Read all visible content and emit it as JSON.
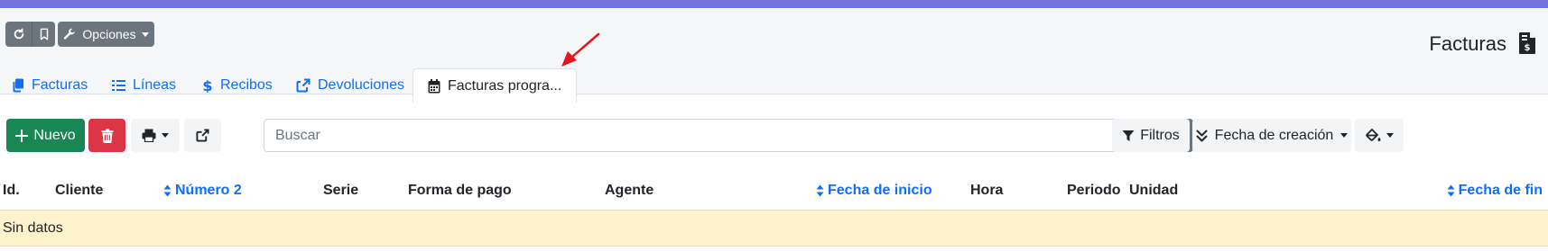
{
  "header": {
    "options_label": "Opciones",
    "page_title": "Facturas"
  },
  "tabs": [
    {
      "label": "Facturas",
      "icon": "copy-icon"
    },
    {
      "label": "Líneas",
      "icon": "list-icon"
    },
    {
      "label": "Recibos",
      "icon": "dollar-icon"
    },
    {
      "label": "Devoluciones",
      "icon": "share-square-icon"
    },
    {
      "label": "Facturas progra...",
      "icon": "calendar-icon",
      "active": true
    }
  ],
  "toolbar": {
    "new_label": "Nuevo",
    "search_placeholder": "Buscar",
    "filters_label": "Filtros",
    "order_label": "Fecha de creación"
  },
  "table": {
    "columns": [
      {
        "label": "Id.",
        "sortable": false
      },
      {
        "label": "Cliente",
        "sortable": false
      },
      {
        "label": "Número 2",
        "sortable": true
      },
      {
        "label": "Serie",
        "sortable": false
      },
      {
        "label": "Forma de pago",
        "sortable": false
      },
      {
        "label": "Agente",
        "sortable": false
      },
      {
        "label": "Fecha de inicio",
        "sortable": true
      },
      {
        "label": "Hora",
        "sortable": false
      },
      {
        "label": "Periodo",
        "sortable": false
      },
      {
        "label": "Unidad",
        "sortable": false
      },
      {
        "label": "Fecha de fin",
        "sortable": true
      }
    ],
    "empty_text": "Sin datos"
  },
  "colors": {
    "top_bar": "#6f74e0",
    "link": "#0d6efd",
    "success": "#198754",
    "danger": "#dc3545",
    "secondary": "#6c757d",
    "empty_row": "#fff3cd",
    "annotation_arrow": "#e8141b"
  }
}
